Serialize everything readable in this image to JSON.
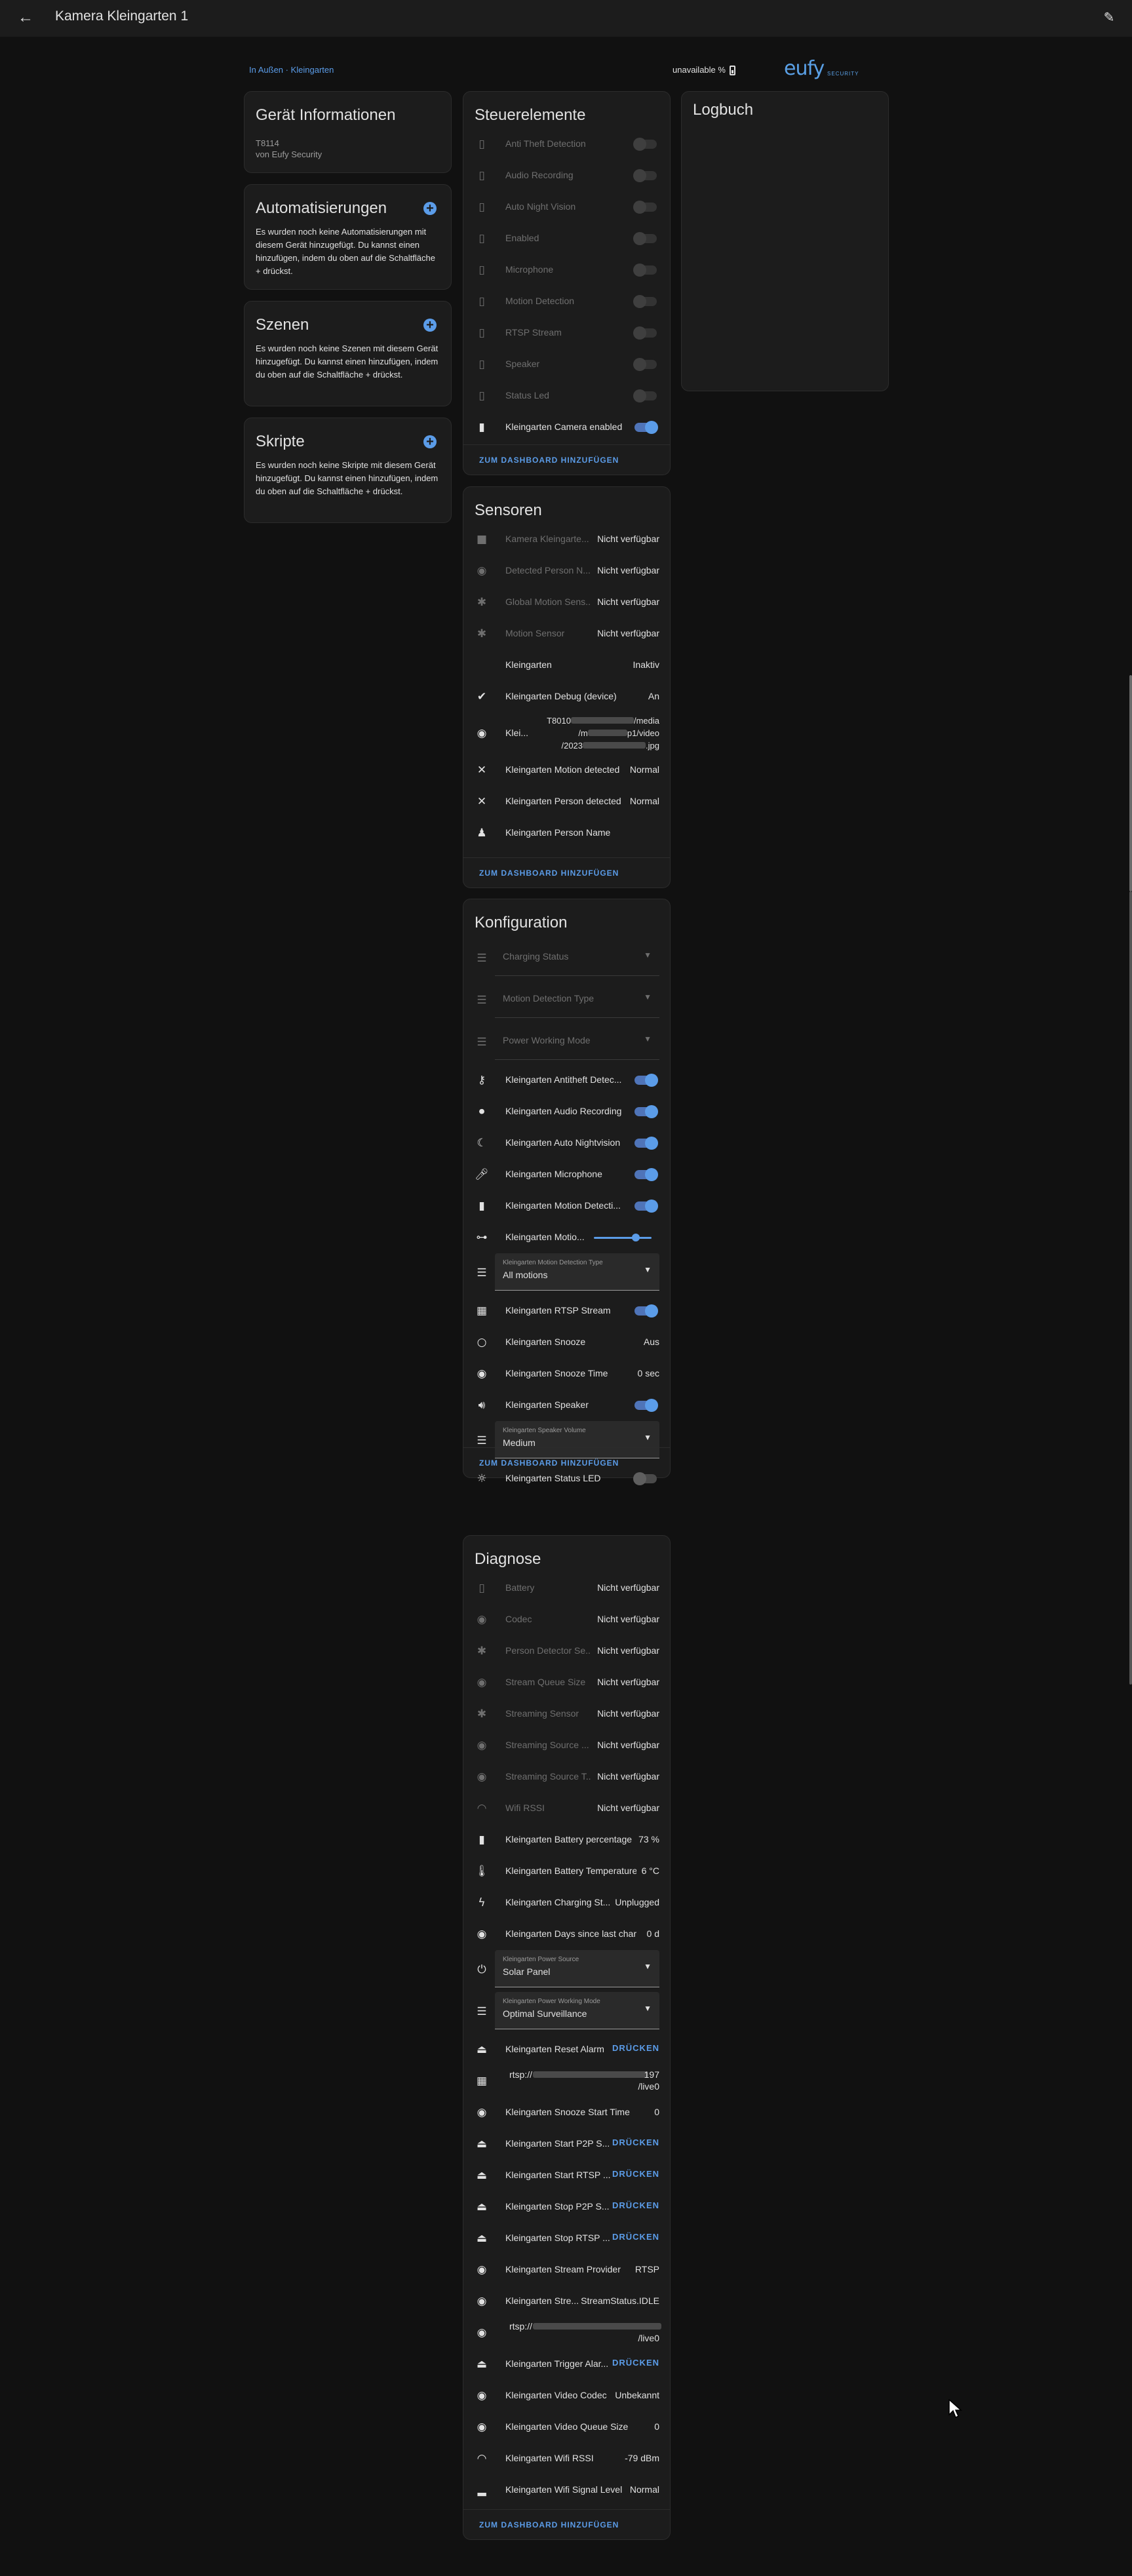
{
  "header": {
    "title": "Kamera Kleingarten 1"
  },
  "breadcrumb": {
    "area": "In Außen",
    "separator": " · ",
    "device": "Kleingarten"
  },
  "battery_status": "unavailable %",
  "brand": {
    "logo_text": "eufy",
    "logo_sub": "SECURITY",
    "accent": "#5aa0e6"
  },
  "device_info": {
    "title": "Gerät Informationen",
    "model": "T8114",
    "maker": "von Eufy Security"
  },
  "automations": {
    "title": "Automatisierungen",
    "text": "Es wurden noch keine Automatisierungen mit diesem Gerät hinzugefügt. Du kannst einen hinzufügen, indem du oben auf die Schaltfläche + drückst."
  },
  "scenes": {
    "title": "Szenen",
    "text": "Es wurden noch keine Szenen mit diesem Gerät hinzugefügt. Du kannst einen hinzufügen, indem du oben auf die Schaltfläche + drückst."
  },
  "scripts": {
    "title": "Skripte",
    "text": "Es wurden noch keine Skripte mit diesem Gerät hinzugefügt. Du kannst einen hinzufügen, indem du oben auf die Schaltfläche + drückst."
  },
  "logbook": {
    "title": "Logbuch"
  },
  "add_to_dashboard": "ZUM DASHBOARD HINZUFÜGEN",
  "press_label": "DRÜCKEN",
  "controls": {
    "title": "Steuerelemente",
    "items": [
      {
        "label": "Anti Theft Detection",
        "icon": "battery-icon",
        "state": "disabled"
      },
      {
        "label": "Audio Recording",
        "icon": "battery-icon",
        "state": "disabled"
      },
      {
        "label": "Auto Night Vision",
        "icon": "battery-icon",
        "state": "disabled"
      },
      {
        "label": "Enabled",
        "icon": "battery-icon",
        "state": "disabled"
      },
      {
        "label": "Microphone",
        "icon": "battery-icon",
        "state": "disabled"
      },
      {
        "label": "Motion Detection",
        "icon": "battery-icon",
        "state": "disabled"
      },
      {
        "label": "RTSP Stream",
        "icon": "battery-icon",
        "state": "disabled"
      },
      {
        "label": "Speaker",
        "icon": "battery-icon",
        "state": "disabled"
      },
      {
        "label": "Status Led",
        "icon": "battery-icon",
        "state": "disabled"
      },
      {
        "label": "Kleingarten Camera enabled",
        "icon": "battery-icon",
        "state": "on"
      }
    ]
  },
  "sensors": {
    "title": "Sensoren",
    "items": [
      {
        "label": "Kamera Kleingarte...",
        "value": "Nicht verfügbar",
        "icon": "camera-icon",
        "off": true
      },
      {
        "label": "Detected Person N...",
        "value": "Nicht verfügbar",
        "icon": "eye-icon",
        "off": true
      },
      {
        "label": "Global Motion Sens...",
        "value": "Nicht verfügbar",
        "icon": "motion-icon",
        "off": true
      },
      {
        "label": "Motion Sensor",
        "value": "Nicht verfügbar",
        "icon": "motion-icon",
        "off": true
      },
      {
        "label": "Kleingarten",
        "value": "Inaktiv",
        "icon": "none",
        "off": false
      },
      {
        "label": "Kleingarten Debug (device)",
        "value": "An",
        "icon": "check-circle-icon",
        "off": false
      },
      {
        "label": "Klei...",
        "value": "T8010 /media /m p1/video /2023 .jpg",
        "icon": "eye-icon",
        "off": false,
        "multiline": [
          "T8010",
          "/media",
          "/m",
          "p1/video",
          "/2023",
          ".jpg"
        ]
      },
      {
        "label": "Kleingarten Motion detected",
        "value": "Normal",
        "icon": "motion-off-icon",
        "off": false
      },
      {
        "label": "Kleingarten Person detected",
        "value": "Normal",
        "icon": "motion-off-icon",
        "off": false
      },
      {
        "label": "Kleingarten Person Name",
        "value": "",
        "icon": "person-icon",
        "off": false
      }
    ]
  },
  "config": {
    "title": "Konfiguration",
    "disabled_selects": [
      "Charging Status",
      "Motion Detection Type",
      "Power Working Mode"
    ],
    "toggles_a": [
      {
        "label": "Kleingarten Antitheft Detec...",
        "icon": "key-icon",
        "state": "on"
      },
      {
        "label": "Kleingarten Audio Recording",
        "icon": "record-icon",
        "state": "on"
      },
      {
        "label": "Kleingarten Auto Nightvision",
        "icon": "night-icon",
        "state": "on"
      },
      {
        "label": "Kleingarten Microphone",
        "icon": "mic-icon",
        "state": "on"
      },
      {
        "label": "Kleingarten Motion Detecti...",
        "icon": "battery-icon",
        "state": "on"
      }
    ],
    "slider": {
      "label": "Kleingarten Motio...",
      "icon": "slider-icon"
    },
    "motion_type": {
      "label": "Kleingarten Motion Detection Type",
      "value": "All motions"
    },
    "rtsp": {
      "label": "Kleingarten RTSP Stream",
      "state": "on"
    },
    "snooze": {
      "label": "Kleingarten Snooze",
      "value": "Aus"
    },
    "snooze_time": {
      "label": "Kleingarten Snooze Time",
      "value": "0 sec"
    },
    "speaker": {
      "label": "Kleingarten Speaker",
      "state": "on"
    },
    "speaker_volume": {
      "label": "Kleingarten Speaker Volume",
      "value": "Medium"
    },
    "status_led": {
      "label": "Kleingarten Status LED",
      "state": "off"
    }
  },
  "diagnose": {
    "title": "Diagnose",
    "items": [
      {
        "label": "Battery",
        "value": "Nicht verfügbar",
        "icon": "battery-icon",
        "off": true
      },
      {
        "label": "Codec",
        "value": "Nicht verfügbar",
        "icon": "eye-icon",
        "off": true
      },
      {
        "label": "Person Detector Se...",
        "value": "Nicht verfügbar",
        "icon": "motion-icon",
        "off": true
      },
      {
        "label": "Stream Queue Size",
        "value": "Nicht verfügbar",
        "icon": "eye-icon",
        "off": true
      },
      {
        "label": "Streaming Sensor",
        "value": "Nicht verfügbar",
        "icon": "motion-icon",
        "off": true
      },
      {
        "label": "Streaming Source ...",
        "value": "Nicht verfügbar",
        "icon": "eye-icon",
        "off": true
      },
      {
        "label": "Streaming Source T...",
        "value": "Nicht verfügbar",
        "icon": "eye-icon",
        "off": true
      },
      {
        "label": "Wifi RSSI",
        "value": "Nicht verfügbar",
        "icon": "wifi-icon",
        "off": true
      },
      {
        "label": "Kleingarten Battery percentage",
        "value": "73 %",
        "icon": "battery-icon",
        "off": false
      },
      {
        "label": "Kleingarten Battery Temperature",
        "value": "6 °C",
        "icon": "thermometer-icon",
        "off": false
      },
      {
        "label": "Kleingarten Charging St...",
        "value": "Unplugged",
        "icon": "battery-charging-icon",
        "off": false
      },
      {
        "label": "Kleingarten Days since last char...",
        "value": "0 d",
        "icon": "eye-icon",
        "off": false
      }
    ],
    "power_source": {
      "label": "Kleingarten Power Source",
      "value": "Solar Panel"
    },
    "power_mode": {
      "label": "Kleingarten Power Working Mode",
      "value": "Optimal Surveillance"
    },
    "items_b": [
      {
        "label": "Kleingarten Reset Alarm",
        "type": "button",
        "icon": "alarm-icon"
      },
      {
        "label": "rtsp://",
        "type": "rtsp",
        "value_a": "197",
        "value_b": "/live0",
        "icon": "film-icon"
      },
      {
        "label": "Kleingarten Snooze Start Time",
        "type": "value",
        "value": "0",
        "icon": "eye-icon"
      },
      {
        "label": "Kleingarten Start P2P S...",
        "type": "button",
        "icon": "alarm-icon"
      },
      {
        "label": "Kleingarten Start RTSP ...",
        "type": "button",
        "icon": "alarm-icon"
      },
      {
        "label": "Kleingarten Stop P2P S...",
        "type": "button",
        "icon": "alarm-icon"
      },
      {
        "label": "Kleingarten Stop RTSP ...",
        "type": "button",
        "icon": "alarm-icon"
      },
      {
        "label": "Kleingarten Stream Provider",
        "type": "value",
        "value": "RTSP",
        "icon": "eye-icon"
      },
      {
        "label": "Kleingarten Stre...",
        "type": "value",
        "value": "StreamStatus.IDLE",
        "icon": "eye-icon"
      },
      {
        "label": "rtsp://",
        "type": "rtsp",
        "value_a": "",
        "value_b": "/live0",
        "icon": "eye-icon"
      },
      {
        "label": "Kleingarten Trigger Alar...",
        "type": "button",
        "icon": "alarm-icon"
      },
      {
        "label": "Kleingarten Video Codec",
        "type": "value",
        "value": "Unbekannt",
        "icon": "eye-icon"
      },
      {
        "label": "Kleingarten Video Queue Size",
        "type": "value",
        "value": "0",
        "icon": "eye-icon"
      },
      {
        "label": "Kleingarten Wifi RSSI",
        "type": "value",
        "value": "-79 dBm",
        "icon": "wifi-icon"
      },
      {
        "label": "Kleingarten Wifi Signal Level",
        "type": "value",
        "value": "Normal",
        "icon": "signal-icon"
      }
    ]
  }
}
